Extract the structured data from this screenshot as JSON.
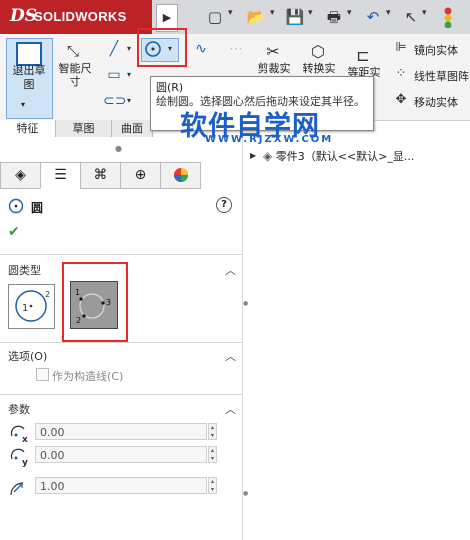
{
  "app": {
    "name": "SOLIDWORKS",
    "logo_mark": "DS"
  },
  "quick_access": {
    "icons": [
      "new-document-icon",
      "open-folder-icon",
      "save-icon",
      "print-icon",
      "undo-icon",
      "select-arrow-icon",
      "options-icon"
    ]
  },
  "ribbon": {
    "exit_sketch": "退出草图",
    "smart_dimension": "智能尺寸",
    "trim": "剪裁实",
    "convert": "转换实",
    "offset": "等距实",
    "mirror": "镜向实体",
    "linear_pattern": "线性草图阵",
    "move": "移动实体"
  },
  "tabs": [
    "特征",
    "草图",
    "曲面"
  ],
  "tooltip": {
    "title": "圆(R)",
    "description": "绘制圆。选择圆心然后拖动来设定其半径。"
  },
  "watermark": {
    "text": "软件自学网",
    "url": "WWW.RJZXW.COM"
  },
  "property_manager": {
    "title": "圆",
    "ok_symbol": "✔",
    "help_symbol": "?",
    "circle_type_label": "圆类型",
    "options_label": "选项(O)",
    "construction_label": "作为构造线(C)",
    "params_label": "参数",
    "x_value": "0.00",
    "y_value": "0.00",
    "radius_value": "1.00"
  },
  "tree": {
    "part_label": "零件3（默认<<默认>_显..."
  }
}
